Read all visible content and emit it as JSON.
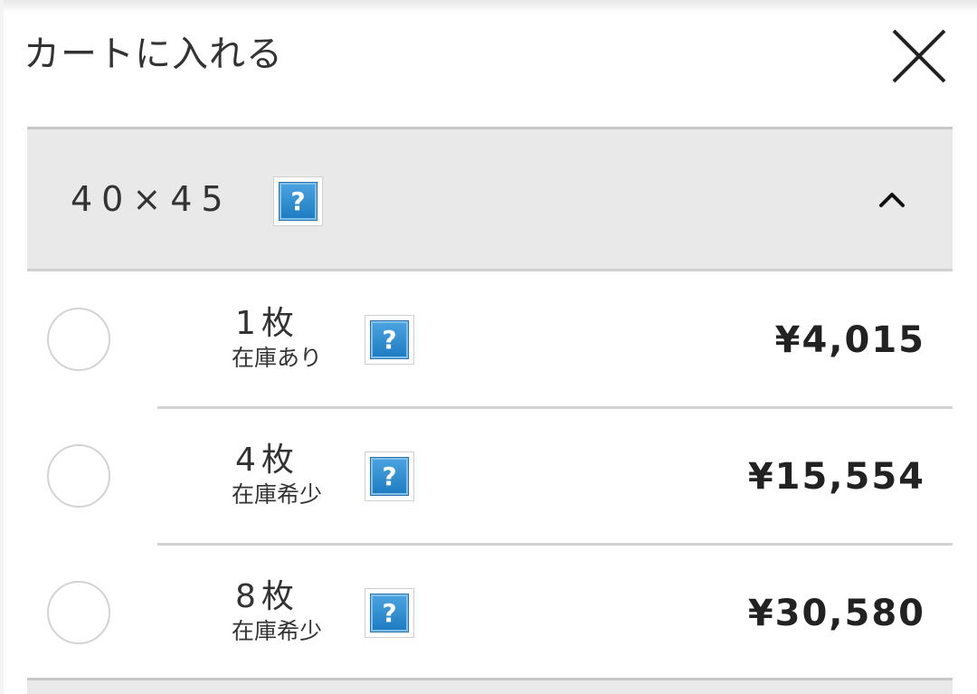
{
  "header": {
    "title": "カートに入れる",
    "close_icon": "close-icon"
  },
  "section": {
    "size_label": "40×45",
    "help_icon": "?",
    "collapse_icon": "chevron-up-icon"
  },
  "options": [
    {
      "quantity": "1枚",
      "stock": "在庫あり",
      "help": "?",
      "price": "¥4,015",
      "selected": false
    },
    {
      "quantity": "4枚",
      "stock": "在庫希少",
      "help": "?",
      "price": "¥15,554",
      "selected": false
    },
    {
      "quantity": "8枚",
      "stock": "在庫希少",
      "help": "?",
      "price": "¥30,580",
      "selected": false
    }
  ],
  "colors": {
    "header_bg": "#e9e9e9",
    "help_blue": "#1f7cc2",
    "text": "#333333"
  }
}
